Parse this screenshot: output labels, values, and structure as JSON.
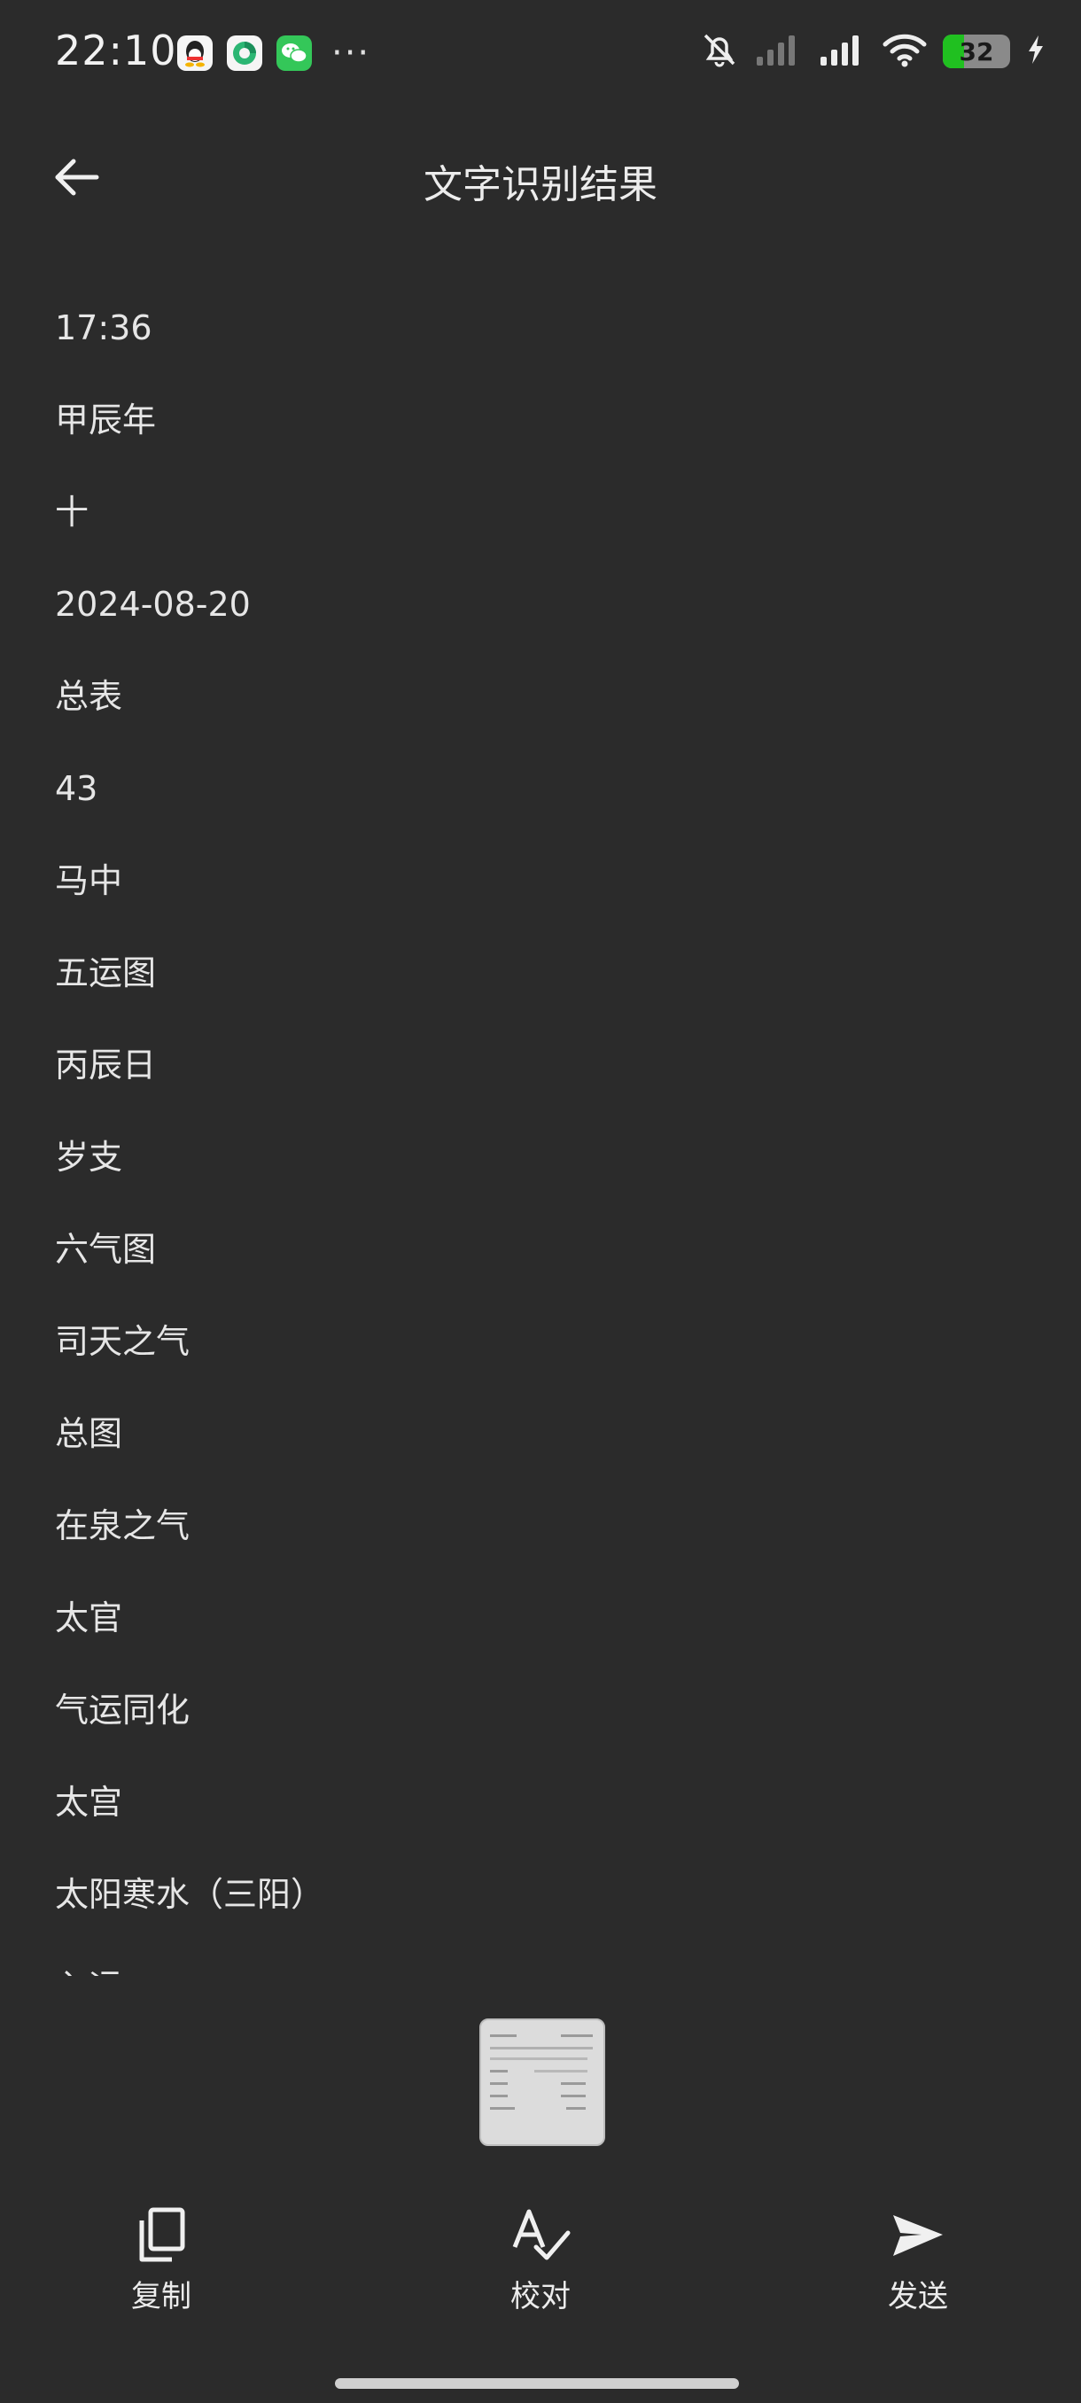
{
  "status_bar": {
    "time": "22:10",
    "more": "···",
    "battery_level": 32,
    "battery_text": "32"
  },
  "header": {
    "title": "文字识别结果",
    "back_icon": "arrow-left-icon"
  },
  "results": [
    "17:36",
    "甲辰年",
    "十",
    "2024-08-20",
    "总表",
    "43",
    "马中",
    "五运图",
    "丙辰日",
    "岁支",
    "六气图",
    "司天之气",
    "总图",
    "在泉之气",
    "太官",
    "气运同化",
    "太宫",
    "太阳寒水（三阳）",
    "入运"
  ],
  "actions": {
    "copy_label": "复制",
    "proofread_label": "校对",
    "send_label": "发送"
  },
  "colors": {
    "background": "#2b2b2b",
    "text": "#e6e6e6",
    "battery_fill": "#20c020"
  }
}
